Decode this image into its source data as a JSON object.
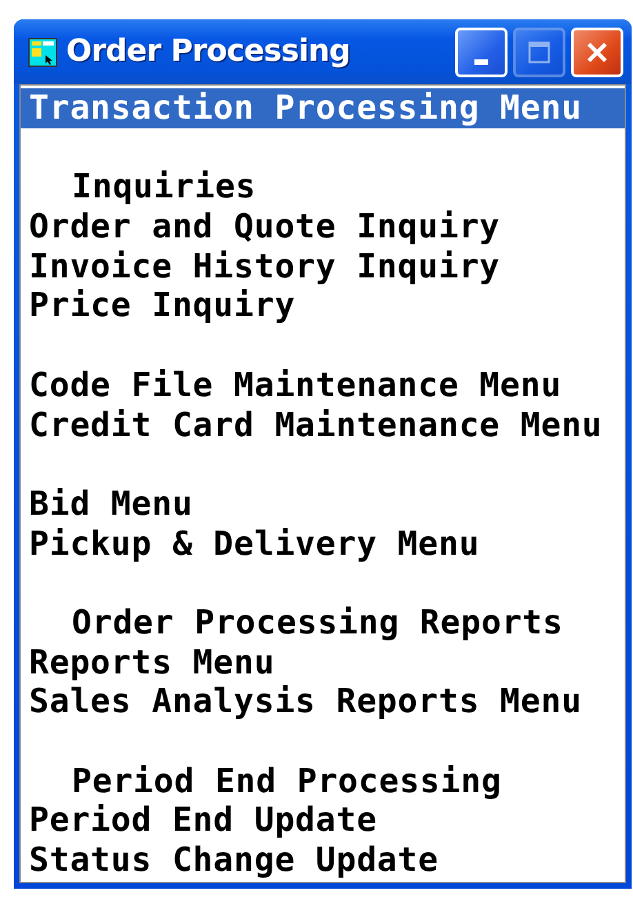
{
  "window": {
    "title": "Order Processing",
    "title_buttons": [
      {
        "kind": "minimize",
        "disabled": false
      },
      {
        "kind": "maximize",
        "disabled": true
      },
      {
        "kind": "close",
        "disabled": false
      }
    ]
  },
  "menu": {
    "sections": [
      {
        "items": [
          {
            "label": "Transaction Processing Menu",
            "selected": true
          }
        ]
      },
      {
        "heading": "Inquiries",
        "items": [
          {
            "label": "Order and Quote Inquiry",
            "selected": false
          },
          {
            "label": "Invoice History Inquiry",
            "selected": false
          },
          {
            "label": "Price Inquiry",
            "selected": false
          }
        ]
      },
      {
        "items": [
          {
            "label": "Code File Maintenance Menu",
            "selected": false
          },
          {
            "label": "Credit Card Maintenance Menu",
            "selected": false
          }
        ]
      },
      {
        "items": [
          {
            "label": "Bid Menu",
            "selected": false
          },
          {
            "label": "Pickup & Delivery Menu",
            "selected": false
          }
        ]
      },
      {
        "heading": "Order Processing Reports",
        "items": [
          {
            "label": "Reports Menu",
            "selected": false
          },
          {
            "label": "Sales Analysis Reports Menu",
            "selected": false
          }
        ]
      },
      {
        "heading": "Period End Processing",
        "items": [
          {
            "label": "Period End Update",
            "selected": false
          },
          {
            "label": "Status Change Update",
            "selected": false
          }
        ]
      }
    ]
  }
}
